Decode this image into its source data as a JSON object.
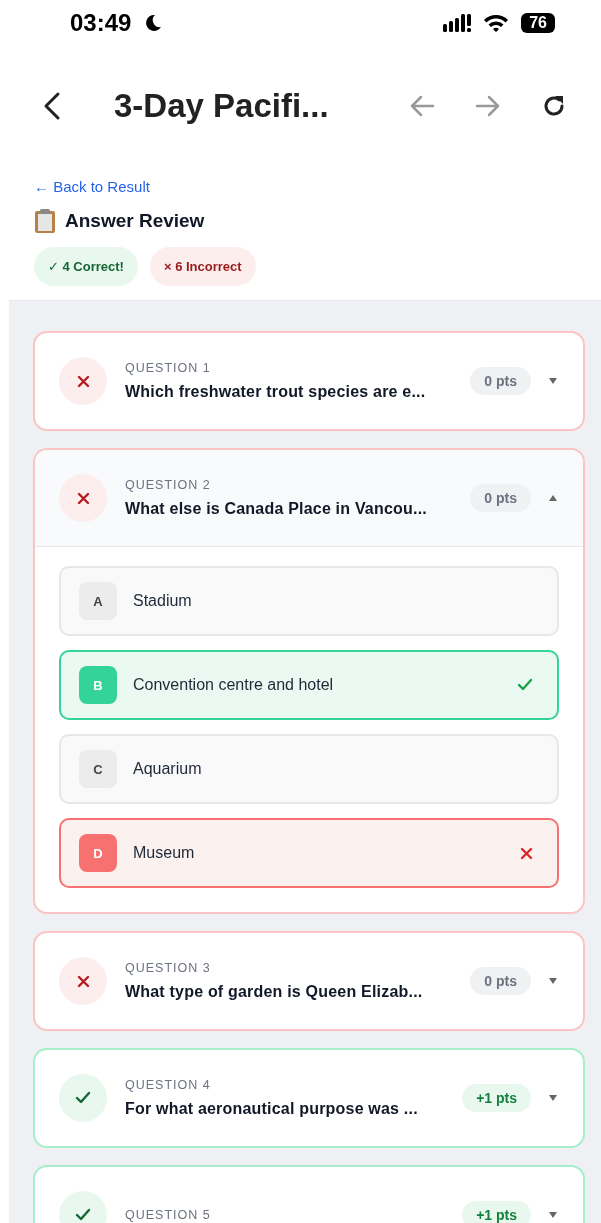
{
  "status_bar": {
    "time": "03:49",
    "battery": "76"
  },
  "header": {
    "title": "3-Day Pacifi..."
  },
  "back_link": "← Back to Result",
  "heading": "Answer Review",
  "summary": [
    {
      "text": "✓ 4 Correct!",
      "kind": "correct"
    },
    {
      "text": "× 6 Incorrect",
      "kind": "wrong"
    }
  ],
  "questions": [
    {
      "label": "QUESTION 1",
      "title": "Which freshwater trout species are e...",
      "correct": false,
      "points": "0 pts",
      "expanded": false
    },
    {
      "label": "QUESTION 2",
      "title": "What else is Canada Place in Vancou...",
      "correct": false,
      "points": "0 pts",
      "expanded": true,
      "options": [
        {
          "letter": "A",
          "text": "Stadium",
          "kind": "neutral"
        },
        {
          "letter": "B",
          "text": "Convention centre and hotel",
          "kind": "correct"
        },
        {
          "letter": "C",
          "text": "Aquarium",
          "kind": "neutral"
        },
        {
          "letter": "D",
          "text": "Museum",
          "kind": "wrong"
        }
      ]
    },
    {
      "label": "QUESTION 3",
      "title": "What type of garden is Queen Elizab...",
      "correct": false,
      "points": "0 pts",
      "expanded": false
    },
    {
      "label": "QUESTION 4",
      "title": "For what aeronautical purpose was ...",
      "correct": true,
      "points": "+1 pts",
      "expanded": false
    },
    {
      "label": "QUESTION 5",
      "correct": true,
      "points": "+1 pts",
      "expanded": false
    }
  ]
}
